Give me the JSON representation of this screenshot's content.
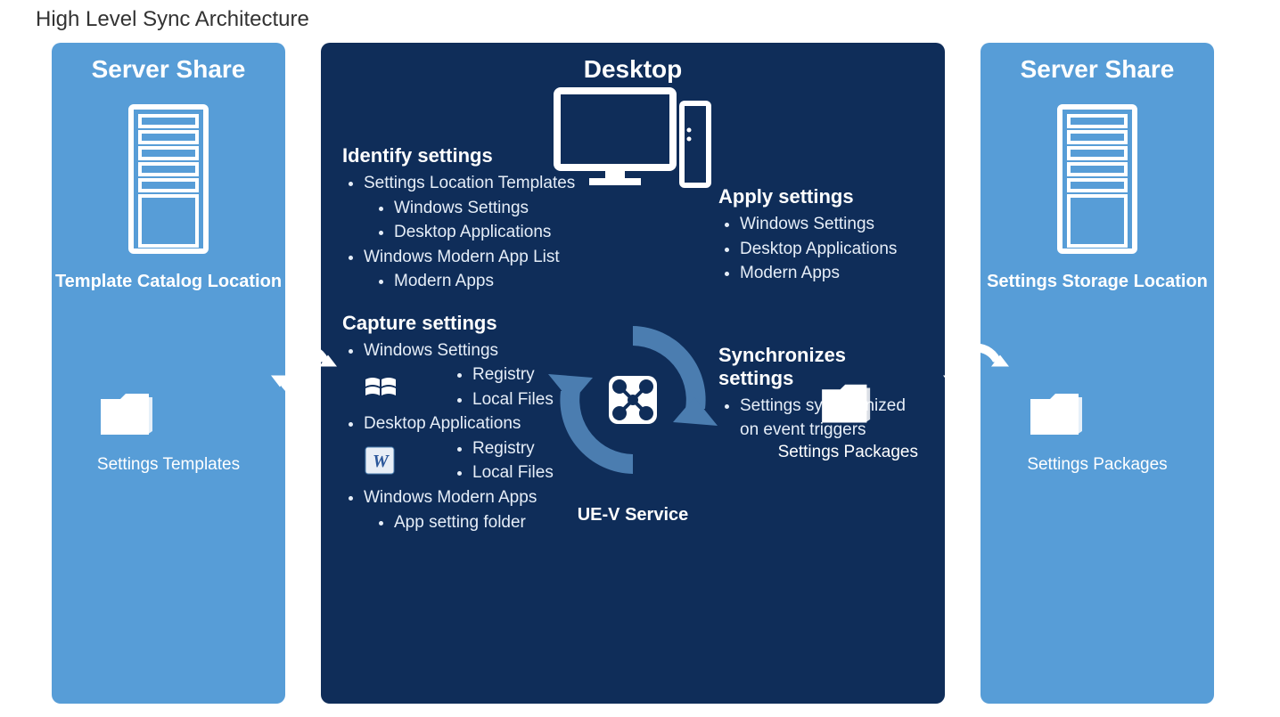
{
  "title": "High Level Sync Architecture",
  "left_box": {
    "header": "Server Share",
    "caption1": "Template Catalog Location",
    "caption2": "Settings Templates"
  },
  "right_box": {
    "header": "Server Share",
    "caption1": "Settings Storage Location",
    "caption2": "Settings Packages"
  },
  "center": {
    "header": "Desktop",
    "uev_label": "UE-V Service",
    "packages_label": "Settings Packages",
    "identify": {
      "head": "Identify settings",
      "items": [
        "Settings Location Templates",
        "Windows Settings",
        "Desktop Applications",
        "Windows Modern App List",
        "Modern Apps"
      ]
    },
    "capture": {
      "head": "Capture settings",
      "win_settings": "Windows Settings",
      "registry": "Registry",
      "local_files": "Local Files",
      "desktop_apps": "Desktop Applications",
      "modern_apps": "Windows Modern Apps",
      "app_setting_folder": "App setting folder"
    },
    "apply": {
      "head": "Apply settings",
      "items": [
        "Windows Settings",
        "Desktop Applications",
        "Modern Apps"
      ]
    },
    "sync": {
      "head": "Synchronizes settings",
      "item": "Settings synchronized on event triggers"
    }
  }
}
